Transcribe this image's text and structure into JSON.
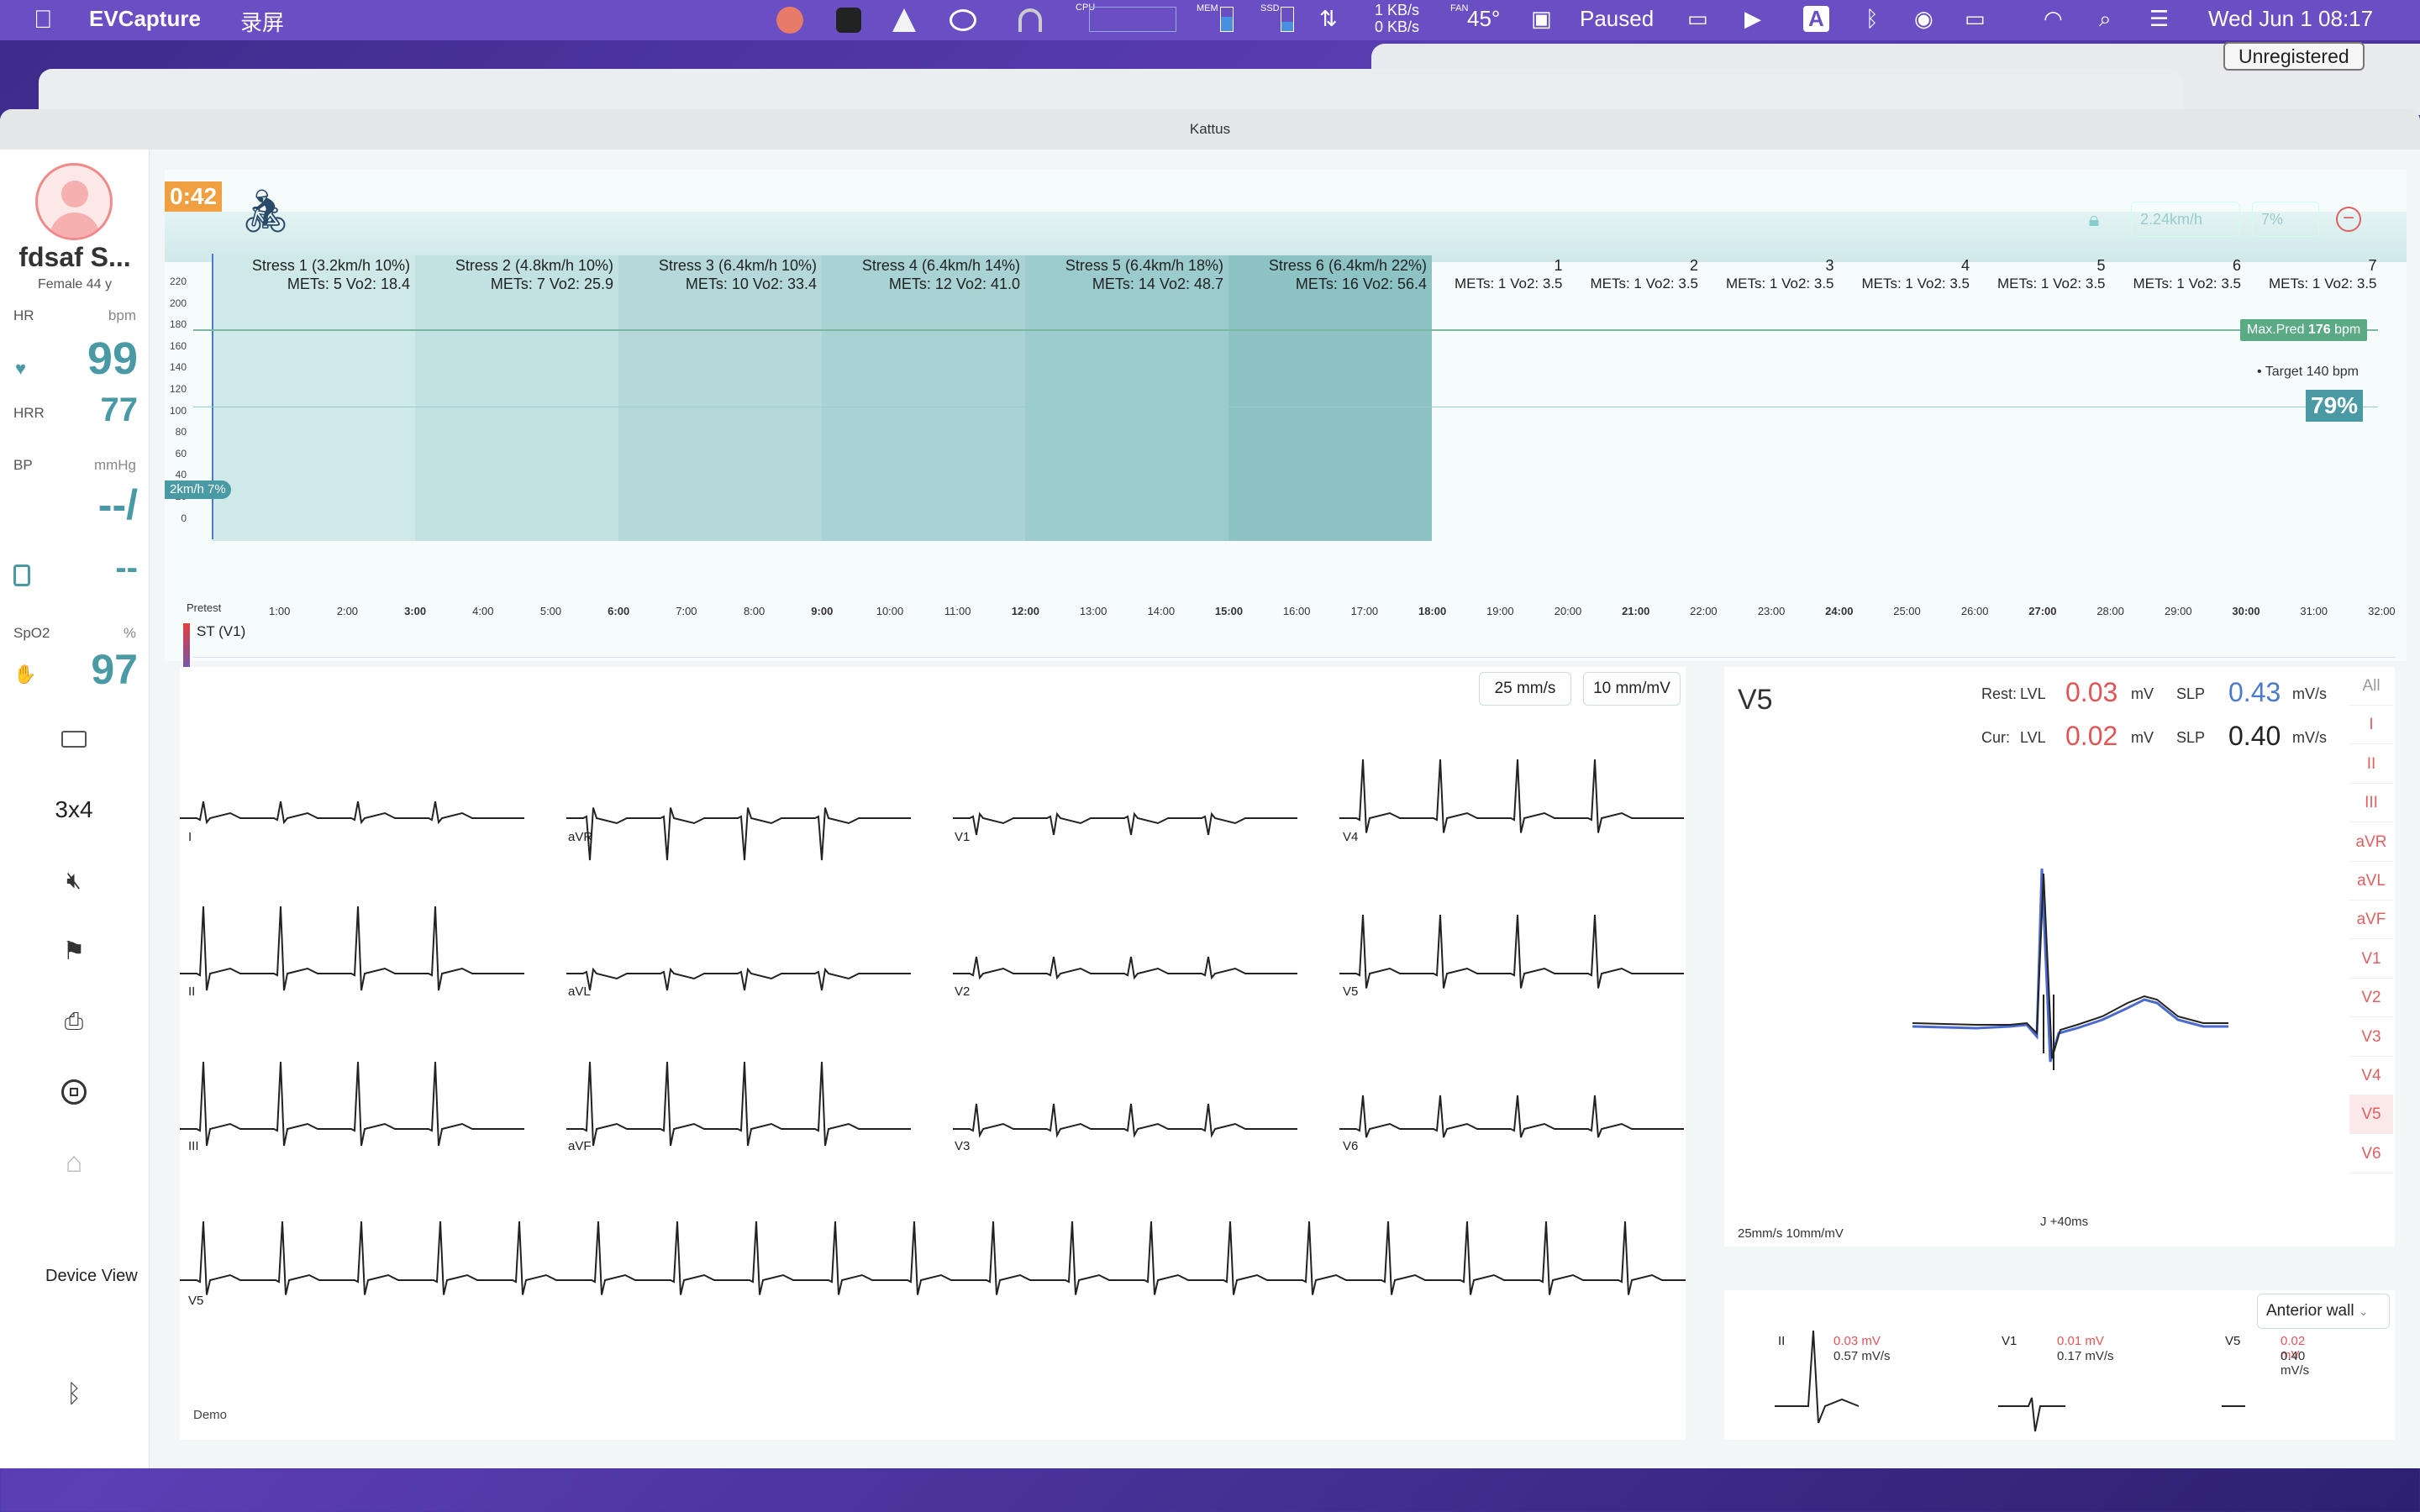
{
  "menubar": {
    "app": "EVCapture",
    "menu1": "录屏",
    "net": "1 KB/s",
    "net2": "0 KB/s",
    "temp": "45°",
    "paused": "Paused",
    "datetime": "Wed Jun 1  08:17",
    "cpu": "CPU",
    "mem": "MEM",
    "ssd": "SSD",
    "fan": "FAN"
  },
  "unregistered": "Unregistered",
  "window_title": "Kattus",
  "patient": {
    "name": "fdsaf S...",
    "info": "Female 44 y"
  },
  "vitals": {
    "hr_label": "HR",
    "hr_unit": "bpm",
    "hr": "99",
    "hrr_label": "HRR",
    "hrr": "77",
    "bp_label": "BP",
    "bp_unit": "mmHg",
    "bp": "--/",
    "bp2": "--",
    "spo2_label": "SpO2",
    "spo2_unit": "%",
    "spo2": "97"
  },
  "sidebar": {
    "layout": "3x4",
    "device_view": "Device View"
  },
  "timer": "0:42",
  "controls": {
    "speed": "2.24km/h",
    "grade": "7%"
  },
  "stages": [
    {
      "name": "Stress 1 (3.2km/h 10%)",
      "mets": "METs: 5",
      "vo2": "Vo2: 18.4"
    },
    {
      "name": "Stress 2 (4.8km/h 10%)",
      "mets": "METs: 7",
      "vo2": "Vo2: 25.9"
    },
    {
      "name": "Stress 3 (6.4km/h 10%)",
      "mets": "METs: 10",
      "vo2": "Vo2: 33.4"
    },
    {
      "name": "Stress 4 (6.4km/h 14%)",
      "mets": "METs: 12",
      "vo2": "Vo2: 41.0"
    },
    {
      "name": "Stress 5 (6.4km/h 18%)",
      "mets": "METs: 14",
      "vo2": "Vo2: 48.7"
    },
    {
      "name": "Stress 6 (6.4km/h 22%)",
      "mets": "METs: 16",
      "vo2": "Vo2: 56.4"
    }
  ],
  "recovery": [
    {
      "name": "1",
      "mets": "METs: 1",
      "vo2": "Vo2: 3.5"
    },
    {
      "name": "2",
      "mets": "METs: 1",
      "vo2": "Vo2: 3.5"
    },
    {
      "name": "3",
      "mets": "METs: 1",
      "vo2": "Vo2: 3.5"
    },
    {
      "name": "4",
      "mets": "METs: 1",
      "vo2": "Vo2: 3.5"
    },
    {
      "name": "5",
      "mets": "METs: 1",
      "vo2": "Vo2: 3.5"
    },
    {
      "name": "6",
      "mets": "METs: 1",
      "vo2": "Vo2: 3.5"
    },
    {
      "name": "7",
      "mets": "METs: 1",
      "vo2": "Vo2: 3.5"
    }
  ],
  "max_pred": "Max.Pred",
  "max_pred_val": "176",
  "max_pred_unit": "bpm",
  "target_label": "Target",
  "target_val": "140",
  "target_unit": "bpm",
  "percent": "79%",
  "speed_badge": "2km/h 7%",
  "pretest": "Pretest",
  "yticks": [
    "220",
    "200",
    "180",
    "160",
    "140",
    "120",
    "100",
    "80",
    "60",
    "40",
    "20",
    "0"
  ],
  "xticks": [
    "1:00",
    "2:00",
    "3:00",
    "4:00",
    "5:00",
    "6:00",
    "7:00",
    "8:00",
    "9:00",
    "10:00",
    "11:00",
    "12:00",
    "13:00",
    "14:00",
    "15:00",
    "16:00",
    "17:00",
    "18:00",
    "19:00",
    "20:00",
    "21:00",
    "22:00",
    "23:00",
    "24:00",
    "25:00",
    "26:00",
    "27:00",
    "28:00",
    "29:00",
    "30:00",
    "31:00",
    "32:00"
  ],
  "st_label": "ST (V1)",
  "ecg": {
    "speed": "25 mm/s",
    "gain": "10 mm/mV",
    "demo": "Demo",
    "leads": [
      "I",
      "aVR",
      "V1",
      "V4",
      "II",
      "aVL",
      "V2",
      "V5",
      "III",
      "aVF",
      "V3",
      "V6",
      "V5"
    ]
  },
  "vpanel": {
    "lead": "V5",
    "rest_label": "Rest:",
    "cur_label": "Cur:",
    "lvl": "LVL",
    "slp": "SLP",
    "mv": "mV",
    "mvs": "mV/s",
    "rest_lvl": "0.03",
    "rest_slp": "0.43",
    "cur_lvl": "0.02",
    "cur_slp": "0.40",
    "j": "J  +40ms",
    "scale": "25mm/s  10mm/mV",
    "leads": [
      "All",
      "I",
      "II",
      "III",
      "aVR",
      "aVL",
      "aVF",
      "V1",
      "V2",
      "V3",
      "V4",
      "V5",
      "V6"
    ]
  },
  "mini": {
    "wall": "Anterior wall",
    "items": [
      {
        "lead": "II",
        "lvl": "0.03 mV",
        "slp": "0.57 mV/s"
      },
      {
        "lead": "V1",
        "lvl": "0.01 mV",
        "slp": "0.17 mV/s"
      },
      {
        "lead": "V5",
        "lvl": "0.02 mV",
        "slp": "0.40 mV/s"
      }
    ]
  },
  "colors": {
    "teal": "#4a9aa5",
    "menubar": "#6a4fc4",
    "accent_red": "#e05555",
    "orange": "#f0a040"
  }
}
